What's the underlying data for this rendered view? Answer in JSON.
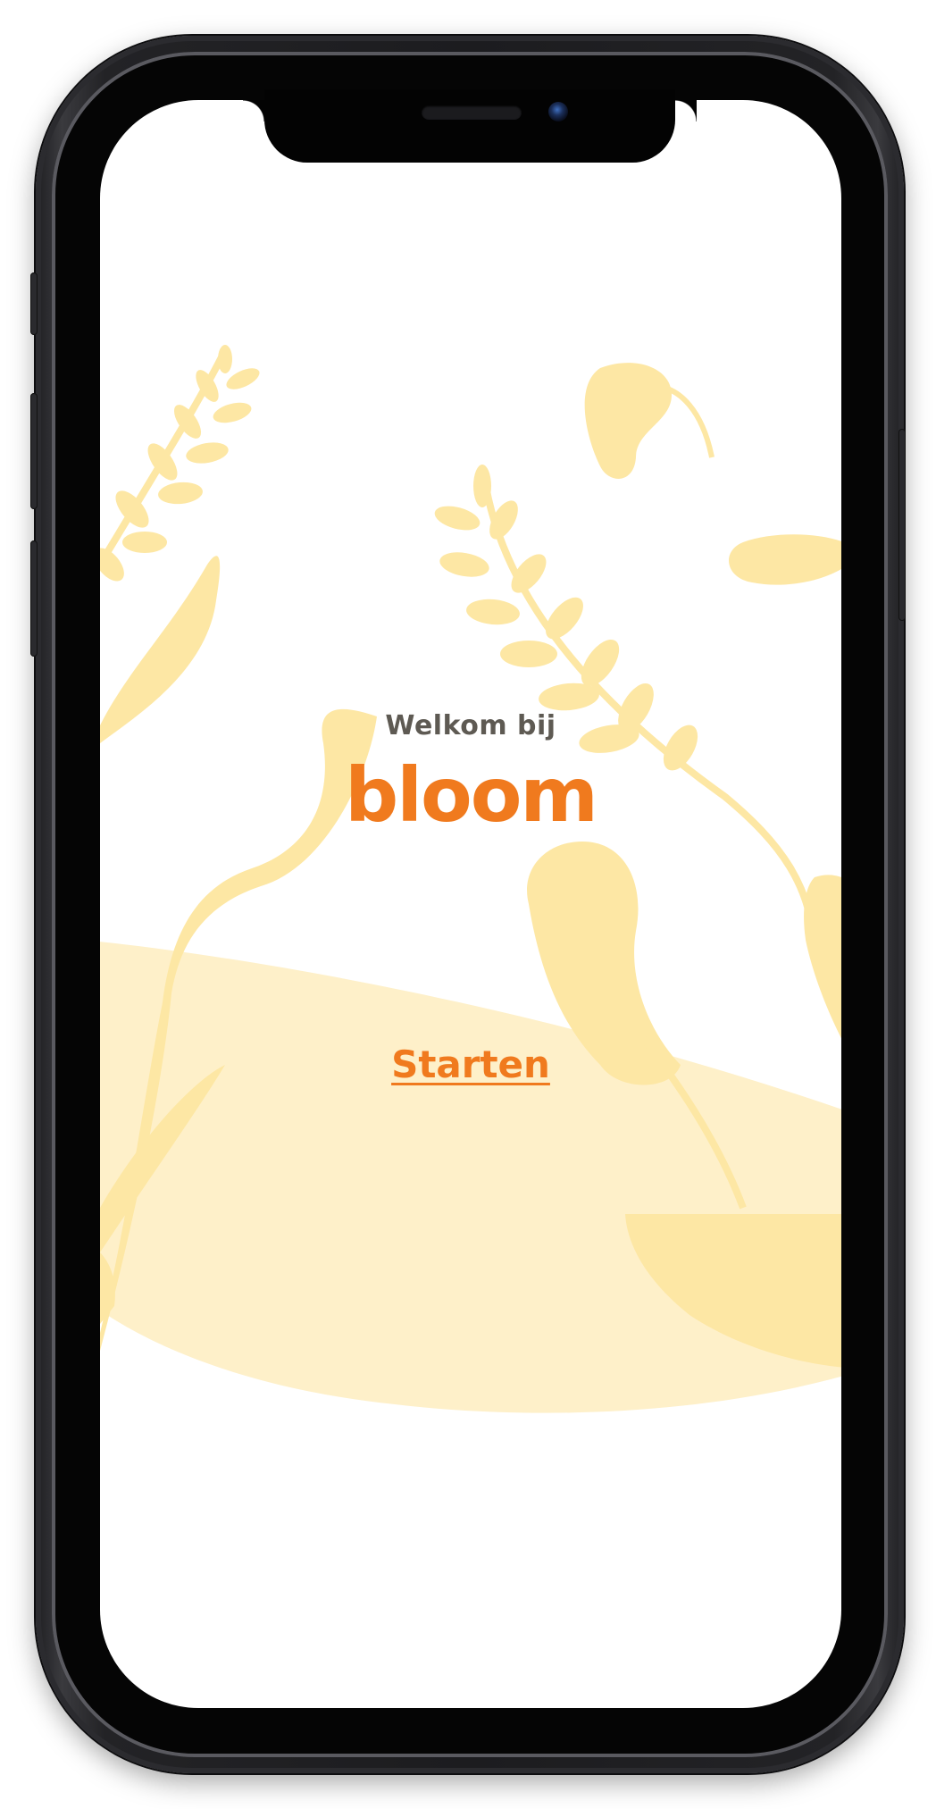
{
  "welcome": {
    "greeting": "Welkom bij",
    "brand_name": "bloom"
  },
  "actions": {
    "start_label": "Starten"
  },
  "colors": {
    "accent": "#f07a1e",
    "greeting_text": "#5e5a53",
    "leaf_primary": "#fde7a4",
    "leaf_light": "#fef0c9",
    "screen_background": "#ffffff",
    "device_frame": "#1f1f22"
  }
}
